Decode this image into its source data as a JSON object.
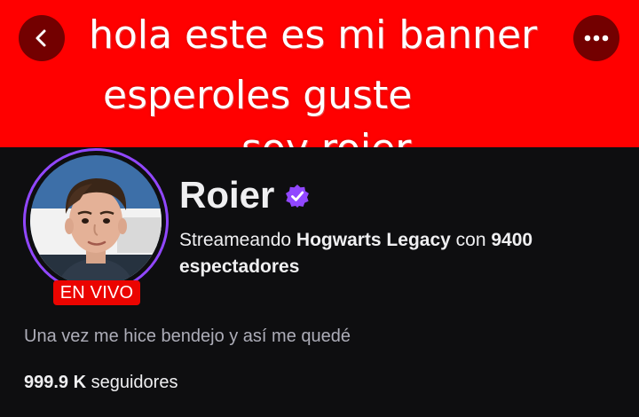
{
  "banner": {
    "lines": [
      "hola este es mi banner",
      "esperoles guste",
      "soy roier"
    ],
    "background_color": "#ff0000"
  },
  "nav": {
    "back_icon": "chevron-left-icon",
    "more_icon": "more-horizontal-icon"
  },
  "channel": {
    "name": "Roier",
    "verified_icon": "verified-badge-icon",
    "live_badge": "EN VIVO",
    "live_color": "#eb0400",
    "ring_color": "#9147ff"
  },
  "stream": {
    "prefix": "Streameando ",
    "game": "Hogwarts Legacy",
    "middle": " con ",
    "viewer_count": "9400",
    "suffix": "espectadores"
  },
  "bio": "Una vez me hice bendejo y así me quedé",
  "followers": {
    "count": "999.9 K",
    "label": " seguidores"
  }
}
